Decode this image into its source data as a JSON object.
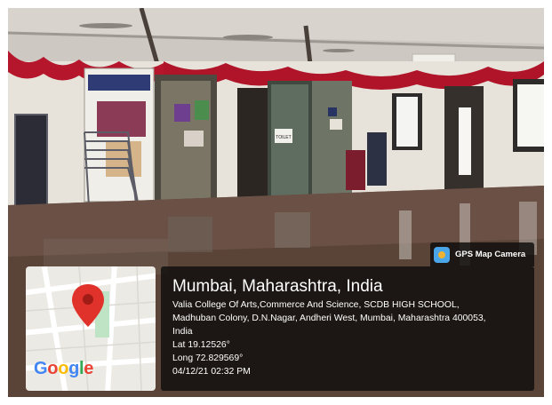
{
  "badge": {
    "label": "GPS Map Camera",
    "icon": "camera-app-icon"
  },
  "location": {
    "city": "Mumbai, Maharashtra, India",
    "address_line1": "Valia College Of Arts,Commerce And Science, SCDB HIGH SCHOOL,",
    "address_line2": "Madhuban Colony, D.N.Nagar, Andheri West, Mumbai, Maharashtra 400053,",
    "address_line3": "India",
    "lat": "Lat 19.12526°",
    "long": "Long 72.829569°",
    "datetime": "04/12/21 02:32 PM"
  },
  "map": {
    "logo": [
      "G",
      "o",
      "o",
      "g",
      "l",
      "e"
    ],
    "logo_colors": [
      "#4285F4",
      "#EA4335",
      "#FBBC05",
      "#4285F4",
      "#34A853",
      "#EA4335"
    ],
    "pin_color": "#e0322b",
    "icon": "map-pin-icon"
  },
  "photo": {
    "signs": [
      "TOILET"
    ],
    "colors": {
      "ceiling": "#cfcbc4",
      "wall": "#e9e6df",
      "floor": "#5a4337",
      "drape": "#b5162b"
    }
  }
}
